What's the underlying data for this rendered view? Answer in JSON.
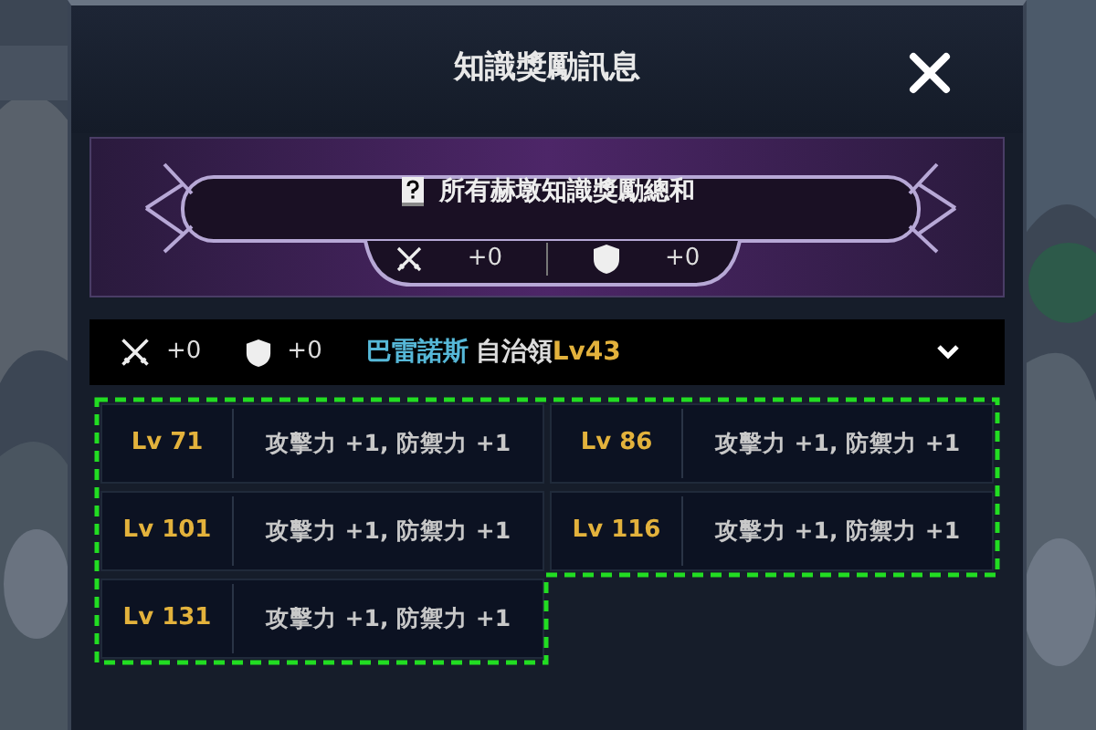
{
  "dialog": {
    "title": "知識獎勵訊息"
  },
  "summary": {
    "heading": "所有赫墩知識獎勵總和",
    "attack": "+0",
    "defense": "+0"
  },
  "region": {
    "attack": "+0",
    "defense": "+0",
    "name": "巴雷諾斯",
    "suffix": "自治領",
    "level": "Lv43"
  },
  "rewards": [
    {
      "level": "Lv 71",
      "bonus": "攻擊力 +1, 防禦力 +1"
    },
    {
      "level": "Lv 86",
      "bonus": "攻擊力 +1, 防禦力 +1"
    },
    {
      "level": "Lv 101",
      "bonus": "攻擊力 +1, 防禦力 +1"
    },
    {
      "level": "Lv 116",
      "bonus": "攻擊力 +1, 防禦力 +1"
    },
    {
      "level": "Lv 131",
      "bonus": "攻擊力 +1, 防禦力 +1"
    }
  ]
}
